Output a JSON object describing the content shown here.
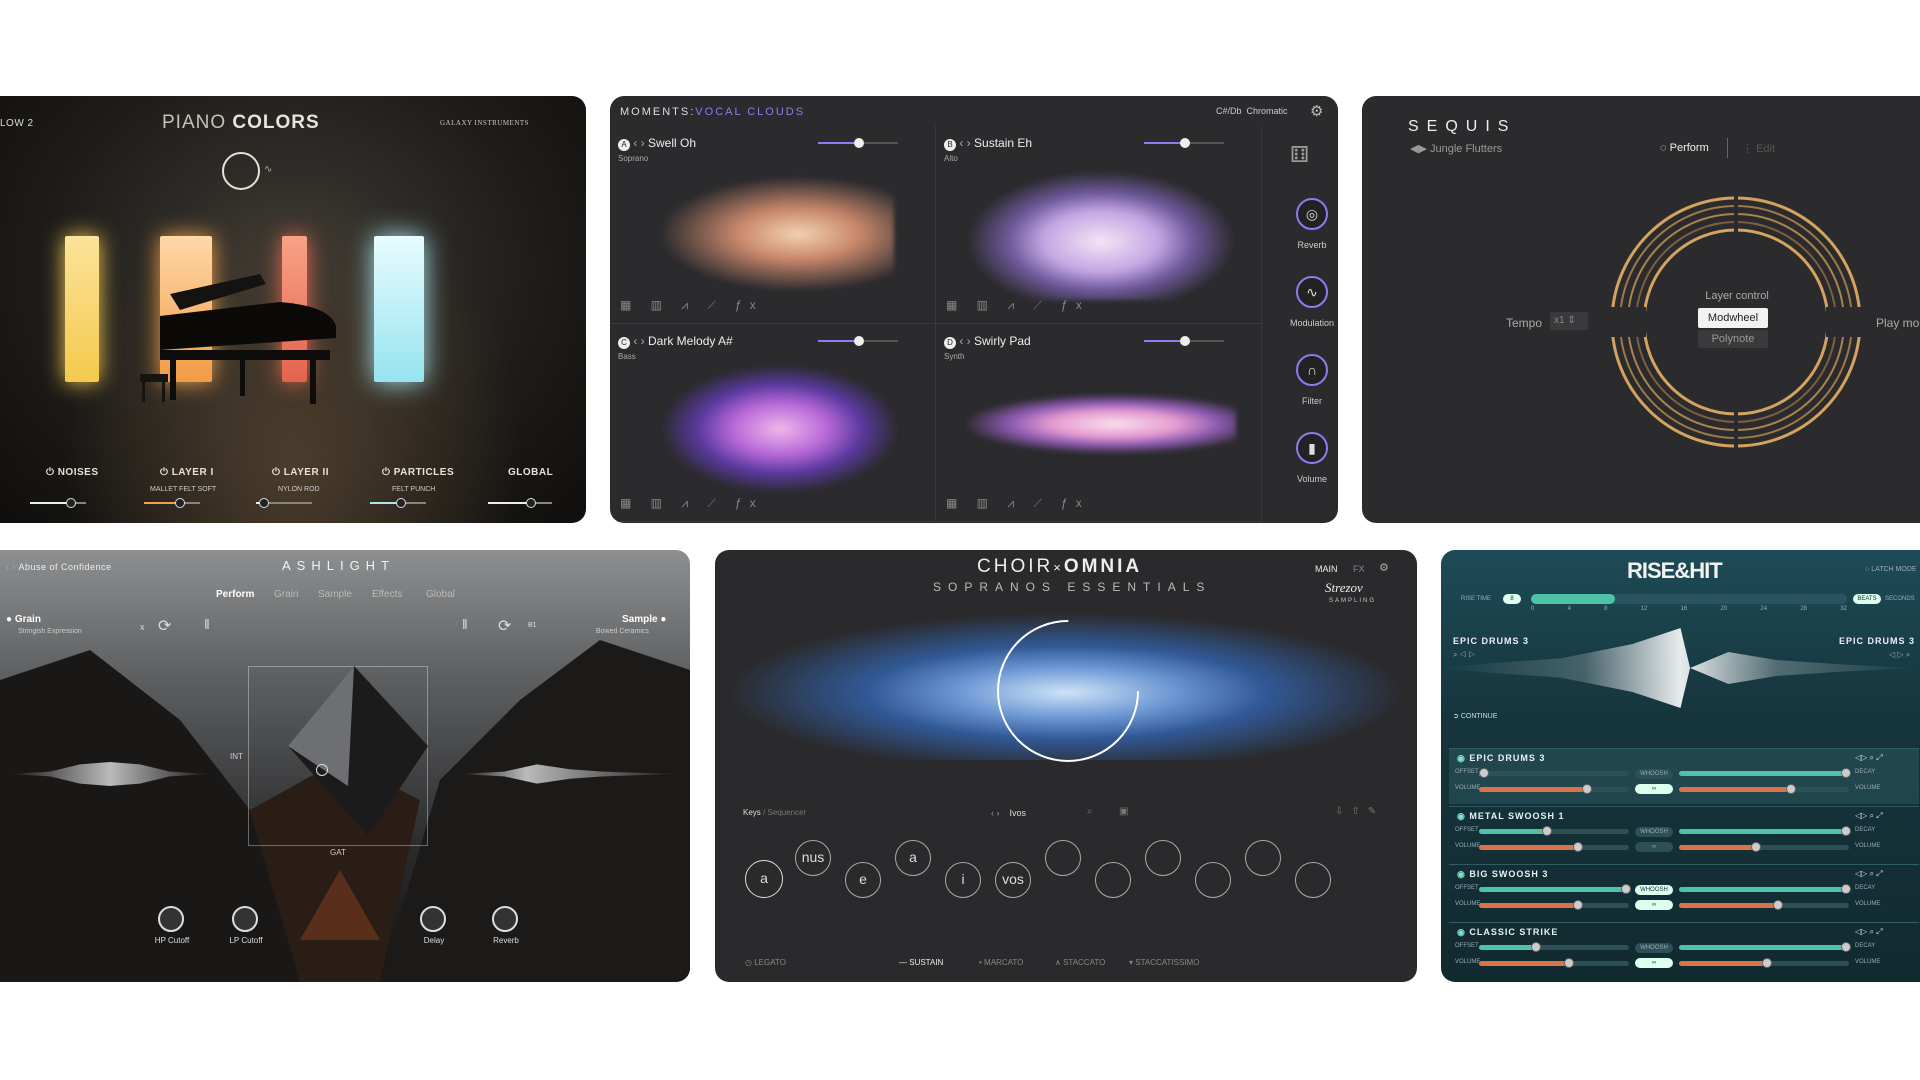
{
  "piano": {
    "layer_label": "LOW 2",
    "title_a": "PIANO",
    "title_b": "COLORS",
    "brand": "GALAXY INSTRUMENTS",
    "sections": [
      {
        "label": "NOISES",
        "sub": ""
      },
      {
        "label": "LAYER I",
        "sub": "MALLET FELT SOFT"
      },
      {
        "label": "LAYER II",
        "sub": "NYLON ROD"
      },
      {
        "label": "PARTICLES",
        "sub": "FELT PUNCH"
      },
      {
        "label": "GLOBAL",
        "sub": ""
      }
    ],
    "colors": {
      "yellow": "#f7d66a",
      "orange": "#f0a24a",
      "red": "#e46c55",
      "cyan": "#a8e6f0"
    }
  },
  "moments": {
    "title_a": "MOMENTS",
    "title_b": "VOCAL CLOUDS",
    "key": "C#/Db",
    "scale": "Chromatic",
    "cells": [
      {
        "letter": "A",
        "name": "Swell Oh",
        "sub": "Soprano"
      },
      {
        "letter": "B",
        "name": "Sustain Eh",
        "sub": "Alto"
      },
      {
        "letter": "C",
        "name": "Dark Melody A#",
        "sub": "Bass"
      },
      {
        "letter": "D",
        "name": "Swirly Pad",
        "sub": "Synth"
      }
    ],
    "side": [
      "Reverb",
      "Modulation",
      "Filter",
      "Volume"
    ],
    "accent": "#8b7cf2"
  },
  "sequis": {
    "title": "SEQUIS",
    "preset": "Jungle Flutters",
    "perform": "Perform",
    "edit": "Edit",
    "tempo_label": "Tempo",
    "tempo_value": "x1",
    "layer_control": "Layer control",
    "modwheel": "Modwheel",
    "polynote": "Polynote",
    "play_mode": "Play mo",
    "accent": "#d4a35f"
  },
  "ashlight": {
    "preset": "Abuse of Confidence",
    "title": "ASHLIGHT",
    "tabs": [
      "Perform",
      "Grain",
      "Sample",
      "Effects",
      "Global"
    ],
    "grain": "Grain",
    "grain_sub": "Stringish Expression",
    "sample": "Sample",
    "sample_sub": "Bowed Ceramics",
    "x_label": "x",
    "b_label": "B1",
    "int": "INT",
    "gat": "GAT",
    "knobs": [
      "HP Cutoff",
      "LP Cutoff",
      "Delay",
      "Reverb"
    ]
  },
  "choir": {
    "title_a": "CHOIR",
    "title_x": "×",
    "title_b": "OMNIA",
    "subtitle": "SOPRANOS ESSENTIALS",
    "nav_main": "MAIN",
    "nav_fx": "FX",
    "brand_script": "Strezov",
    "brand_sub": "SAMPLING",
    "keys": "Keys",
    "sequencer": "Sequencer",
    "preset": "Ivos",
    "syllables": [
      "a",
      "nus",
      "e",
      "a",
      "i",
      "vos"
    ],
    "arts": [
      "LEGATO",
      "SUSTAIN",
      "MARCATO",
      "STACCATO",
      "STACCATISSIMO"
    ]
  },
  "rise": {
    "title": "RISE&HIT",
    "latch": "LATCH MODE",
    "rise_time": "RISE TIME",
    "rise_val": "8",
    "ticks": [
      "0",
      "4",
      "8",
      "12",
      "16",
      "20",
      "24",
      "28",
      "32"
    ],
    "beats": "BEATS",
    "seconds": "SECONDS",
    "left_name": "EPIC DRUMS 3",
    "right_name": "EPIC DRUMS 3",
    "continue": "CONTINUE",
    "offset": "OFFSET",
    "volume": "VOLUME",
    "whoosh": "WHOOSH",
    "decay": "DECAY",
    "rows": [
      {
        "name": "EPIC DRUMS 3",
        "offset": 0.02,
        "volume": 0.72,
        "r_offset": 0.98,
        "r_volume": 0.66
      },
      {
        "name": "METAL SWOOSH 1",
        "offset": 0.45,
        "volume": 0.66,
        "r_offset": 0.98,
        "r_volume": 0.45
      },
      {
        "name": "BIG SWOOSH 3",
        "offset": 0.98,
        "volume": 0.66,
        "r_offset": 0.98,
        "r_volume": 0.58
      },
      {
        "name": "CLASSIC STRIKE",
        "offset": 0.38,
        "volume": 0.6,
        "r_offset": 0.98,
        "r_volume": 0.52
      }
    ]
  }
}
